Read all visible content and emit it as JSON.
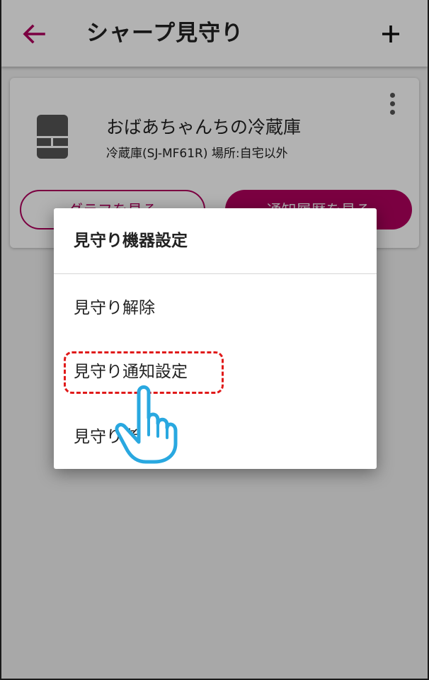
{
  "appbar": {
    "back_icon": "arrow-left-icon",
    "title": "シャープ見守り",
    "add_icon": "plus-icon"
  },
  "device_card": {
    "icon": "refrigerator-icon",
    "name": "おばあちゃんちの冷蔵庫",
    "subtitle": "冷蔵庫(SJ-MF61R) 場所:自宅以外",
    "more_icon": "more-vertical-icon",
    "graph_button": "グラフを見る",
    "history_button": "通知履歴を見る"
  },
  "dialog": {
    "title": "見守り機器設定",
    "items": [
      "見守り解除",
      "見守り通知設定",
      "見守り者一覧"
    ]
  },
  "overlay": {
    "pointer_icon": "hand-pointer-icon"
  },
  "colors": {
    "accent": "#b0005e",
    "highlight": "#e01a1a",
    "pointer": "#29a8e0"
  }
}
